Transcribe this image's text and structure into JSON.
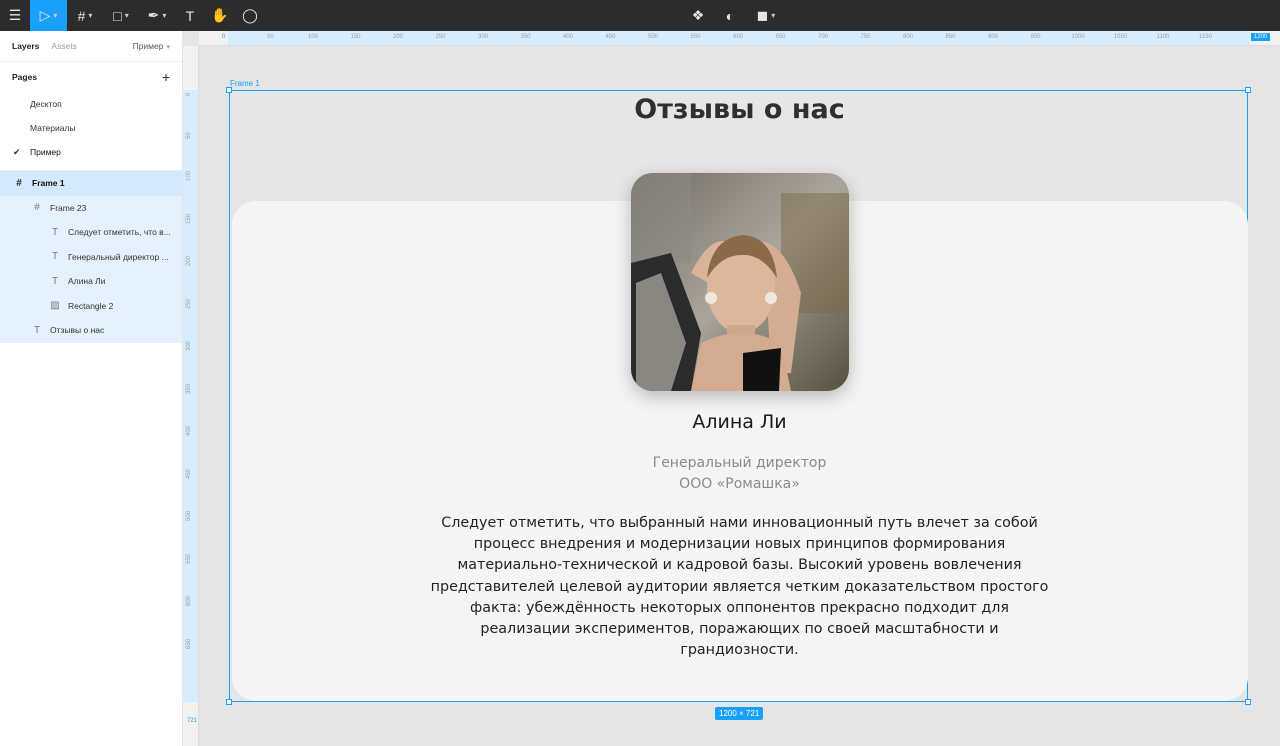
{
  "toolbar": {
    "tools": [
      {
        "name": "main-menu-icon",
        "glyph": "☰"
      },
      {
        "name": "move-tool-icon",
        "glyph": "▷"
      },
      {
        "name": "frame-tool-icon",
        "glyph": "#"
      },
      {
        "name": "shape-tool-icon",
        "glyph": "□"
      },
      {
        "name": "pen-tool-icon",
        "glyph": "✒"
      },
      {
        "name": "text-tool-icon",
        "glyph": "T"
      },
      {
        "name": "hand-tool-icon",
        "glyph": "✋"
      },
      {
        "name": "comment-tool-icon",
        "glyph": "◯"
      }
    ],
    "center_icons": [
      {
        "name": "component-icon",
        "glyph": "❖"
      },
      {
        "name": "mask-icon",
        "glyph": "◐"
      },
      {
        "name": "boolean-icon",
        "glyph": "◼"
      }
    ]
  },
  "left_panel": {
    "tabs": {
      "layers": "Layers",
      "assets": "Assets",
      "page": "Пример"
    },
    "pages_title": "Pages",
    "pages": [
      "Десктоп",
      "Материалы",
      "Пример"
    ],
    "selected_page": "Пример",
    "layers": [
      {
        "label": "Frame 1",
        "icon": "frame-icon",
        "glyph": "#"
      },
      {
        "label": "Frame 23",
        "icon": "frame-icon",
        "glyph": "#"
      },
      {
        "label": "Следует отметить, что в...",
        "icon": "text-icon",
        "glyph": "T"
      },
      {
        "label": "Генеральный директор ...",
        "icon": "text-icon",
        "glyph": "T"
      },
      {
        "label": "Алина Ли",
        "icon": "text-icon",
        "glyph": "T"
      },
      {
        "label": "Rectangle 2",
        "icon": "image-icon",
        "glyph": "▨"
      },
      {
        "label": "Отзывы о нас",
        "icon": "text-icon",
        "glyph": "T"
      }
    ]
  },
  "rulers": {
    "top_start": "0",
    "top_ticks": [
      "50",
      "100",
      "150",
      "200",
      "250",
      "300",
      "350",
      "400",
      "450",
      "500",
      "550",
      "600",
      "650",
      "700",
      "750",
      "800",
      "850",
      "900",
      "950",
      "1000",
      "1050",
      "1100",
      "1150"
    ],
    "top_end": "1200",
    "left_ticks": [
      "0",
      "50",
      "100",
      "150",
      "200",
      "250",
      "300",
      "350",
      "400",
      "450",
      "500",
      "550",
      "600",
      "650"
    ],
    "left_end": "721"
  },
  "canvas": {
    "frame_label": "Frame 1",
    "heading": "Отзывы о нас",
    "name": "Алина Ли",
    "position_line1": "Генеральный директор",
    "position_line2": "ООО «Ромашка»",
    "quote": "Следует отметить, что выбранный нами инновационный путь влечет за собой процесс внедрения и модернизации новых принципов формирования материально-технической и кадровой базы. Высокий уровень вовлечения представителей целевой аудитории является четким доказательством простого факта: убеждённость некоторых оппонентов прекрасно подходит для реализации экспериментов, поражающих по своей масштабности и грандиозности.",
    "size_badge": "1200 × 721"
  },
  "colors": {
    "accent": "#18a0fb",
    "toolbar_bg": "#2c2c2c",
    "canvas_bg": "#e5e5e5",
    "card_bg": "#f5f5f5"
  }
}
